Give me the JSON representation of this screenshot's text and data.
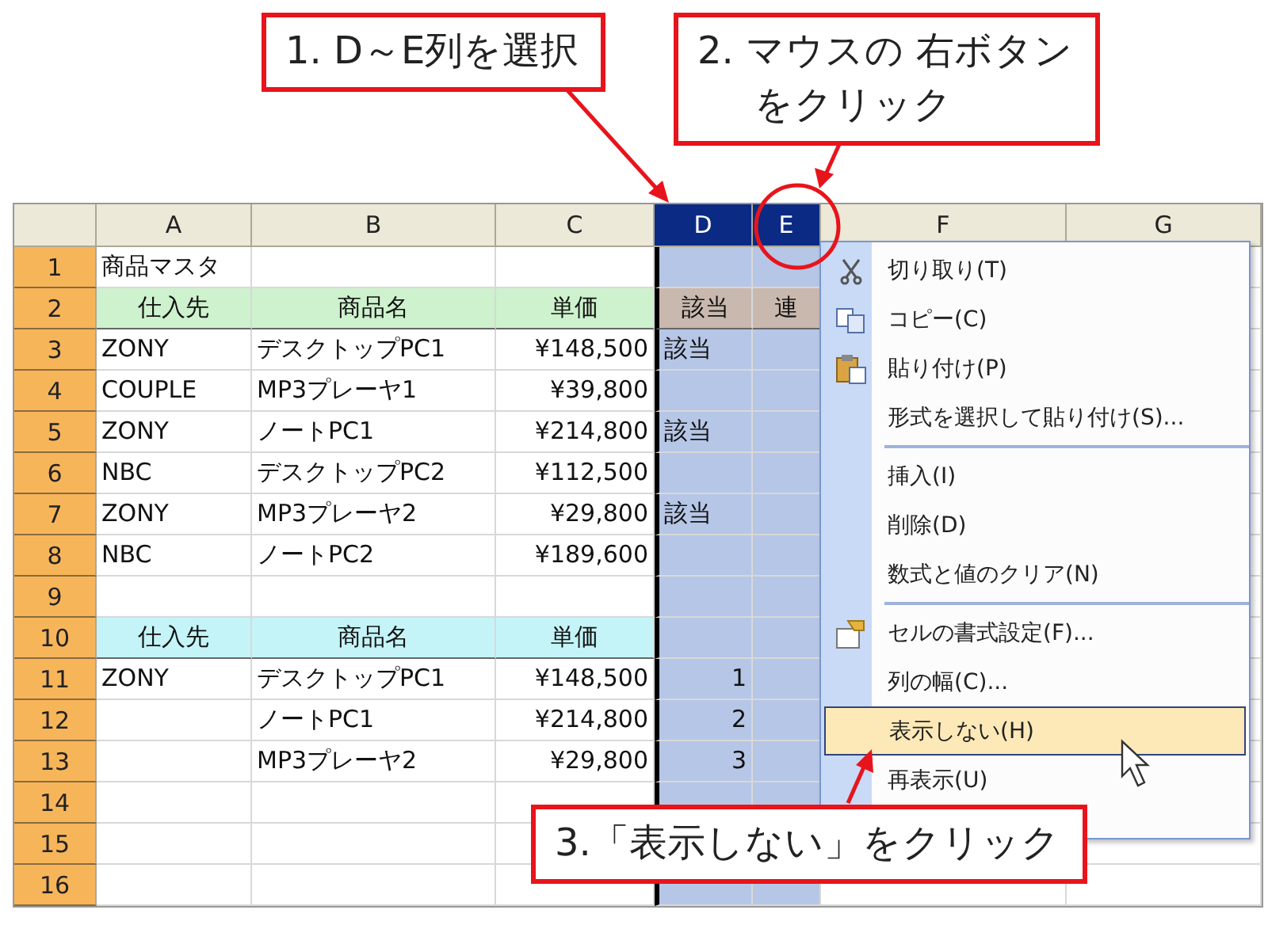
{
  "callouts": [
    {
      "lines": [
        "1. D～E列を選択"
      ]
    },
    {
      "lines": [
        "2. マウスの 右ボタン",
        "をクリック"
      ]
    },
    {
      "lines": [
        "3.「表示しない」をクリック"
      ]
    }
  ],
  "columns": [
    {
      "label": "A",
      "selected": false
    },
    {
      "label": "B",
      "selected": false
    },
    {
      "label": "C",
      "selected": false
    },
    {
      "label": "D",
      "selected": true
    },
    {
      "label": "E",
      "selected": true
    },
    {
      "label": "F",
      "selected": false
    },
    {
      "label": "G",
      "selected": false
    }
  ],
  "rows": [
    {
      "number": "1",
      "cells": [
        {
          "text": "商品マスタ",
          "kind": "text"
        },
        null,
        null,
        null,
        null,
        null,
        null
      ]
    },
    {
      "number": "2",
      "cells": [
        {
          "text": "仕入先",
          "kind": "head_green"
        },
        {
          "text": "商品名",
          "kind": "head_green"
        },
        {
          "text": "単価",
          "kind": "head_green"
        },
        {
          "text": "該当",
          "kind": "head_tan"
        },
        {
          "text": "連",
          "kind": "head_tan"
        },
        null,
        null
      ]
    },
    {
      "number": "3",
      "cells": [
        {
          "text": "ZONY",
          "kind": "text"
        },
        {
          "text": "デスクトップPC1",
          "kind": "text"
        },
        {
          "text": "¥148,500",
          "kind": "num"
        },
        {
          "text": "該当",
          "kind": "text"
        },
        null,
        null,
        null
      ]
    },
    {
      "number": "4",
      "cells": [
        {
          "text": "COUPLE",
          "kind": "text"
        },
        {
          "text": "MP3プレーヤ1",
          "kind": "text"
        },
        {
          "text": "¥39,800",
          "kind": "num"
        },
        null,
        null,
        null,
        null
      ]
    },
    {
      "number": "5",
      "cells": [
        {
          "text": "ZONY",
          "kind": "text"
        },
        {
          "text": "ノートPC1",
          "kind": "text"
        },
        {
          "text": "¥214,800",
          "kind": "num"
        },
        {
          "text": "該当",
          "kind": "text"
        },
        null,
        null,
        null
      ]
    },
    {
      "number": "6",
      "cells": [
        {
          "text": "NBC",
          "kind": "text"
        },
        {
          "text": "デスクトップPC2",
          "kind": "text"
        },
        {
          "text": "¥112,500",
          "kind": "num"
        },
        null,
        null,
        null,
        null
      ]
    },
    {
      "number": "7",
      "cells": [
        {
          "text": "ZONY",
          "kind": "text"
        },
        {
          "text": "MP3プレーヤ2",
          "kind": "text"
        },
        {
          "text": "¥29,800",
          "kind": "num"
        },
        {
          "text": "該当",
          "kind": "text"
        },
        null,
        null,
        null
      ]
    },
    {
      "number": "8",
      "cells": [
        {
          "text": "NBC",
          "kind": "text"
        },
        {
          "text": "ノートPC2",
          "kind": "text"
        },
        {
          "text": "¥189,600",
          "kind": "num"
        },
        null,
        null,
        null,
        null
      ]
    },
    {
      "number": "9",
      "cells": [
        null,
        null,
        null,
        null,
        null,
        null,
        null
      ]
    },
    {
      "number": "10",
      "cells": [
        {
          "text": "仕入先",
          "kind": "head_cyan"
        },
        {
          "text": "商品名",
          "kind": "head_cyan"
        },
        {
          "text": "単価",
          "kind": "head_cyan"
        },
        null,
        null,
        null,
        null
      ]
    },
    {
      "number": "11",
      "cells": [
        {
          "text": "ZONY",
          "kind": "text"
        },
        {
          "text": "デスクトップPC1",
          "kind": "text"
        },
        {
          "text": "¥148,500",
          "kind": "num"
        },
        {
          "text": "1",
          "kind": "num"
        },
        null,
        null,
        null
      ]
    },
    {
      "number": "12",
      "cells": [
        null,
        {
          "text": "ノートPC1",
          "kind": "text"
        },
        {
          "text": "¥214,800",
          "kind": "num"
        },
        {
          "text": "2",
          "kind": "num"
        },
        null,
        null,
        null
      ]
    },
    {
      "number": "13",
      "cells": [
        null,
        {
          "text": "MP3プレーヤ2",
          "kind": "text"
        },
        {
          "text": "¥29,800",
          "kind": "num"
        },
        {
          "text": "3",
          "kind": "num"
        },
        null,
        null,
        null
      ]
    },
    {
      "number": "14",
      "cells": [
        null,
        null,
        null,
        null,
        null,
        null,
        null
      ]
    },
    {
      "number": "15",
      "cells": [
        null,
        null,
        null,
        null,
        null,
        null,
        null
      ]
    },
    {
      "number": "16",
      "cells": [
        null,
        null,
        null,
        null,
        null,
        null,
        null
      ]
    }
  ],
  "context_menu": {
    "items": [
      {
        "label": "切り取り(T)",
        "selected": false,
        "divider_above": false
      },
      {
        "label": "コピー(C)",
        "selected": false,
        "divider_above": false
      },
      {
        "label": "貼り付け(P)",
        "selected": false,
        "divider_above": false
      },
      {
        "label": "形式を選択して貼り付け(S)...",
        "selected": false,
        "divider_above": false
      },
      {
        "label": "挿入(I)",
        "selected": false,
        "divider_above": true
      },
      {
        "label": "削除(D)",
        "selected": false,
        "divider_above": false
      },
      {
        "label": "数式と値のクリア(N)",
        "selected": false,
        "divider_above": false
      },
      {
        "label": "セルの書式設定(F)...",
        "selected": false,
        "divider_above": true
      },
      {
        "label": "列の幅(C)...",
        "selected": false,
        "divider_above": false
      },
      {
        "label": "表示しない(H)",
        "selected": true,
        "divider_above": false
      },
      {
        "label": "再表示(U)",
        "selected": false,
        "divider_above": false
      }
    ]
  }
}
